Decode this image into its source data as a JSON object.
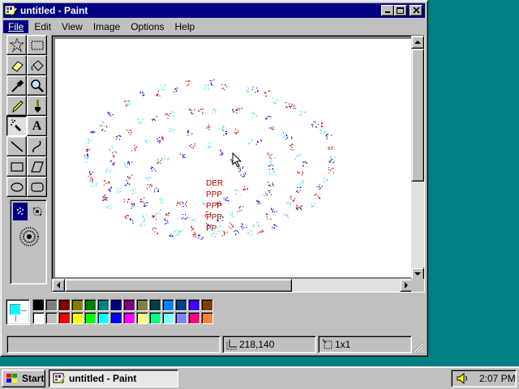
{
  "window": {
    "title": "untitled - Paint"
  },
  "menu": [
    {
      "label": "File",
      "active": true
    },
    {
      "label": "Edit",
      "active": false
    },
    {
      "label": "View",
      "active": false
    },
    {
      "label": "Image",
      "active": false
    },
    {
      "label": "Options",
      "active": false
    },
    {
      "label": "Help",
      "active": false
    }
  ],
  "tools": [
    {
      "name": "free-form-select-icon",
      "selected": false
    },
    {
      "name": "rect-select-icon",
      "selected": false
    },
    {
      "name": "eraser-icon",
      "selected": false
    },
    {
      "name": "fill-bucket-icon",
      "selected": false
    },
    {
      "name": "color-picker-icon",
      "selected": false
    },
    {
      "name": "magnifier-icon",
      "selected": false
    },
    {
      "name": "pencil-icon",
      "selected": false
    },
    {
      "name": "brush-icon",
      "selected": false
    },
    {
      "name": "airbrush-icon",
      "selected": true
    },
    {
      "name": "text-icon",
      "selected": false
    },
    {
      "name": "line-icon",
      "selected": false
    },
    {
      "name": "curve-icon",
      "selected": false
    },
    {
      "name": "rectangle-icon",
      "selected": false
    },
    {
      "name": "polygon-icon",
      "selected": false
    },
    {
      "name": "ellipse-icon",
      "selected": false
    },
    {
      "name": "rounded-rect-icon",
      "selected": false
    }
  ],
  "text_tool_glyph": "A",
  "canvas": {
    "text_lines": [
      "DER",
      "PPP",
      "PPP",
      "PPP",
      "PP"
    ]
  },
  "palette": {
    "foreground": "#00ffff",
    "background": "#ffffff",
    "colors": [
      "#000000",
      "#808080",
      "#800000",
      "#808000",
      "#008000",
      "#008080",
      "#000080",
      "#800080",
      "#808040",
      "#004040",
      "#0080ff",
      "#004080",
      "#4000ff",
      "#804000",
      "#ffffff",
      "#c0c0c0",
      "#ff0000",
      "#ffff00",
      "#00ff00",
      "#00ffff",
      "#0000ff",
      "#ff00ff",
      "#ffff80",
      "#00ff80",
      "#80ffff",
      "#8080ff",
      "#ff0080",
      "#ff8040"
    ]
  },
  "status": {
    "message": "",
    "coords": "218,140",
    "size": "1x1"
  },
  "taskbar": {
    "start_label": "Start",
    "task_label": "untitled - Paint",
    "clock": "2:07 PM"
  }
}
